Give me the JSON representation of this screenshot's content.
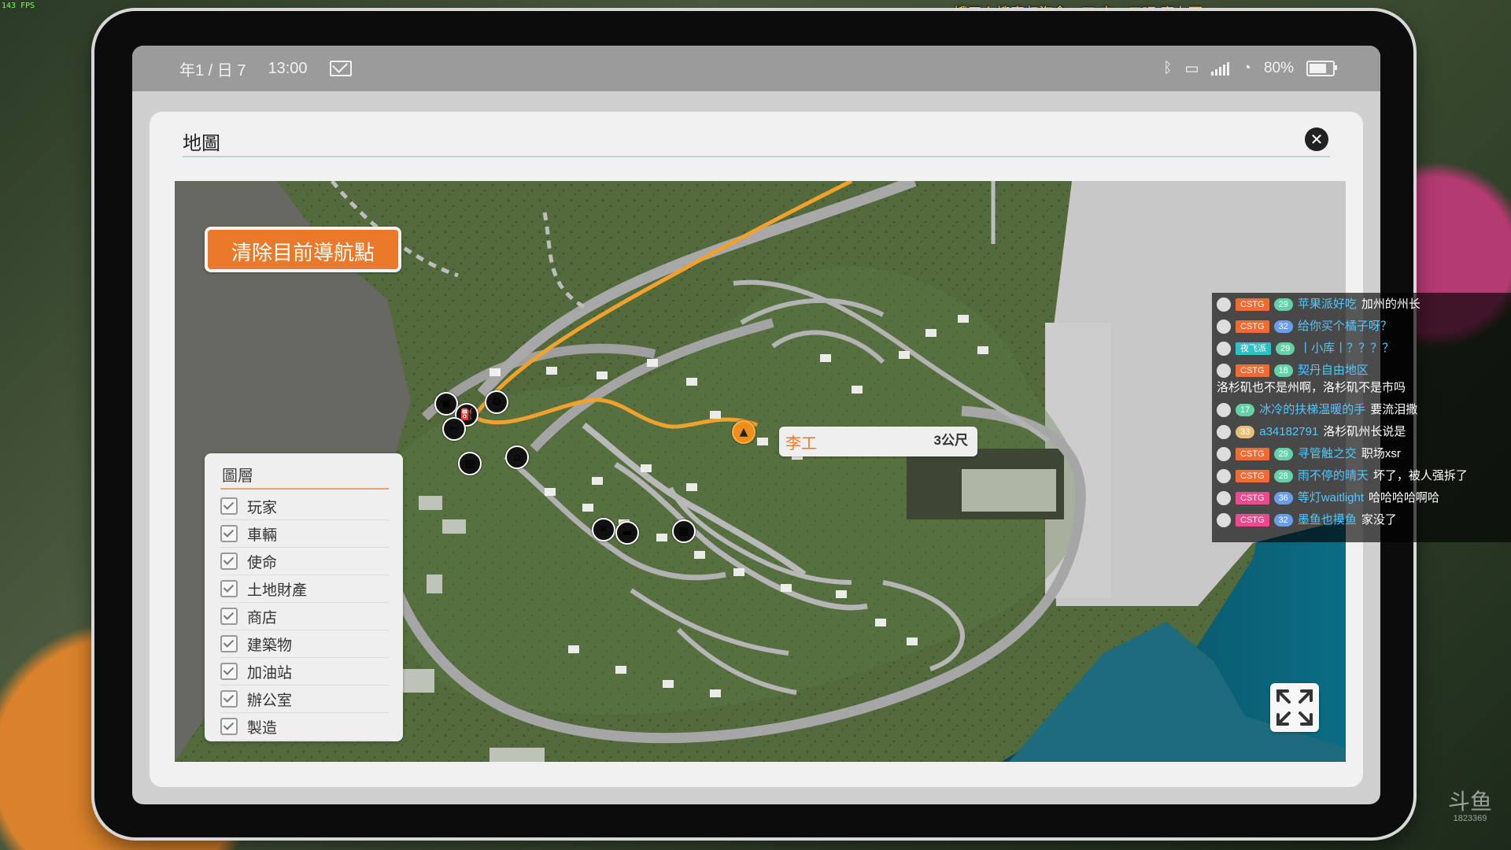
{
  "overlay": {
    "fps": "143 FPS",
    "banner": "饿了么搜索归海念一刀 来一口吧 魔女可",
    "watermark_logo": "斗鱼",
    "watermark_id": "1823369"
  },
  "status_bar": {
    "date": "年1 / 日 7",
    "time": "13:00",
    "battery_percent": "80%"
  },
  "app": {
    "title": "地圖",
    "close_symbol": "✕"
  },
  "map": {
    "clear_button_label": "清除目前導航點",
    "location_name": "李工",
    "distance": "3公尺"
  },
  "layers": {
    "title": "圖層",
    "items": [
      "玩家",
      "車輛",
      "使命",
      "土地財產",
      "商店",
      "建築物",
      "加油站",
      "辦公室",
      "製造"
    ]
  },
  "chat": [
    {
      "badge": "CSTG",
      "level": "29",
      "user": "苹果派好吃",
      "text": "加州的州长",
      "level_color": "green"
    },
    {
      "badge": "CSTG",
      "level": "32",
      "user": "给你买个橘子呀？",
      "text": "",
      "level_color": "blue"
    },
    {
      "badge": "夜飞派",
      "level": "29",
      "user": "丨小库丨？？？？",
      "text": "",
      "level_color": "green"
    },
    {
      "badge": "CSTG",
      "level": "18",
      "user": "契丹自由地区",
      "text": "洛杉矶也不是州啊，洛杉矶不是市吗",
      "level_color": "green"
    },
    {
      "badge": "",
      "level": "17",
      "user": "冰冷的扶梯温暖的手",
      "text": "要流泪撒",
      "level_color": "green"
    },
    {
      "badge": "",
      "level": "33",
      "user": "a34182791",
      "text": "洛杉矶州长说是",
      "level_color": "green"
    },
    {
      "badge": "CSTG",
      "level": "29",
      "user": "寻管触之交",
      "text": "职场xsr",
      "level_color": "green"
    },
    {
      "badge": "CSTG",
      "level": "28",
      "user": "雨不停的晴天",
      "text": "坏了，被人强拆了",
      "level_color": "green"
    },
    {
      "badge": "CSTG",
      "level": "36",
      "user": "等灯waitlight",
      "text": "哈哈哈哈啊哈",
      "level_color": "blue"
    },
    {
      "badge": "CSTG",
      "level": "32",
      "user": "墨鱼也摸鱼",
      "text": "家没了",
      "level_color": "blue"
    }
  ],
  "icons": {
    "bluetooth": "bluetooth-icon",
    "signal": "signal-icon",
    "wifi": "wifi-icon",
    "battery": "battery-icon",
    "mail": "mail-icon",
    "close": "close-icon",
    "fullscreen": "fullscreen-icon",
    "player": "player-location-icon"
  },
  "colors": {
    "accent_orange": "#ea7a2a",
    "status_gray": "#9b9b9b",
    "chat_user_blue": "#4ec8ff",
    "route_orange": "#f0a22d"
  }
}
